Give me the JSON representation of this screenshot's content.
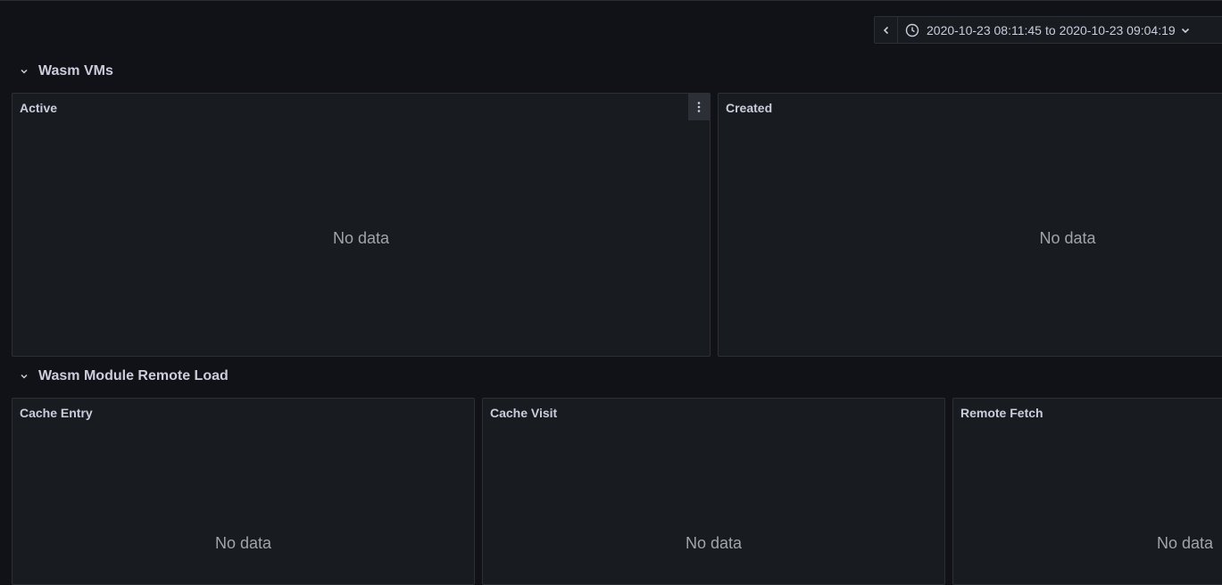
{
  "time_picker": {
    "from": "2020-10-23 08:11:45",
    "separator": "to",
    "to": "2020-10-23 09:04:19"
  },
  "rows": [
    {
      "title": "Wasm VMs",
      "panels": [
        {
          "title": "Active",
          "empty_text": "No data"
        },
        {
          "title": "Created",
          "empty_text": "No data"
        }
      ]
    },
    {
      "title": "Wasm Module Remote Load",
      "panels": [
        {
          "title": "Cache Entry",
          "empty_text": "No data"
        },
        {
          "title": "Cache Visit",
          "empty_text": "No data"
        },
        {
          "title": "Remote Fetch",
          "empty_text": "No data"
        }
      ]
    }
  ],
  "icons": {
    "time_back": "chevron-left-icon",
    "clock": "clock-icon",
    "row_toggle": "chevron-down-icon",
    "panel_menu": "kebab-menu-icon"
  }
}
